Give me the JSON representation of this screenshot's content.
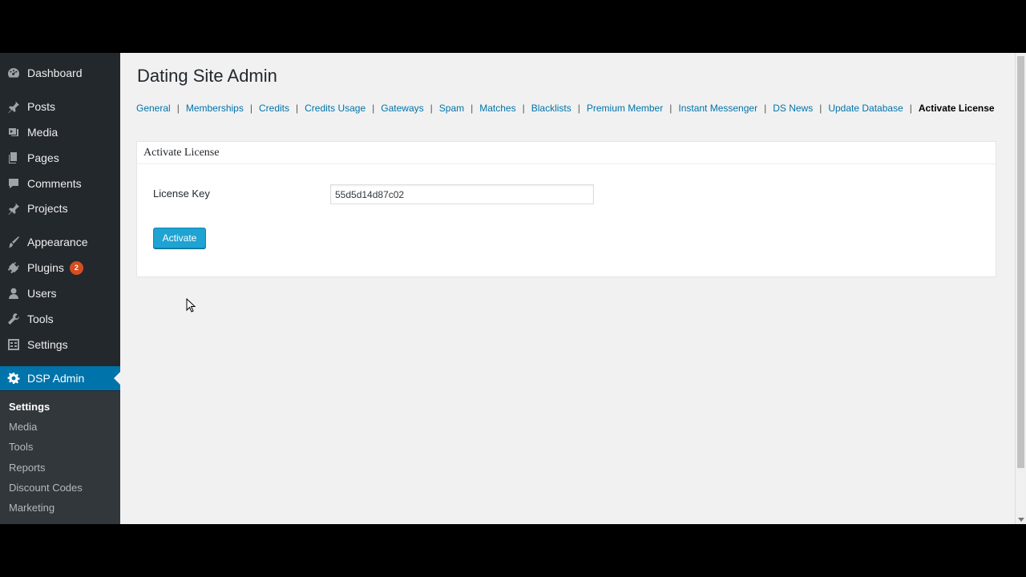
{
  "sidebar": {
    "items": [
      {
        "label": "Dashboard",
        "icon": "dashboard-icon"
      },
      {
        "label": "Posts",
        "icon": "pin-icon"
      },
      {
        "label": "Media",
        "icon": "media-icon"
      },
      {
        "label": "Pages",
        "icon": "pages-icon"
      },
      {
        "label": "Comments",
        "icon": "comment-icon"
      },
      {
        "label": "Projects",
        "icon": "pin-icon"
      },
      {
        "label": "Appearance",
        "icon": "brush-icon"
      },
      {
        "label": "Plugins",
        "icon": "plugin-icon",
        "badge": "2"
      },
      {
        "label": "Users",
        "icon": "user-icon"
      },
      {
        "label": "Tools",
        "icon": "wrench-icon"
      },
      {
        "label": "Settings",
        "icon": "settings-icon"
      },
      {
        "label": "DSP Admin",
        "icon": "gear-icon"
      }
    ],
    "submenu": [
      "Settings",
      "Media",
      "Tools",
      "Reports",
      "Discount Codes",
      "Marketing"
    ]
  },
  "page": {
    "title": "Dating Site Admin"
  },
  "tabs": [
    "General",
    "Memberships",
    "Credits",
    "Credits Usage",
    "Gateways",
    "Spam",
    "Matches",
    "Blacklists",
    "Premium Member",
    "Instant Messenger",
    "DS News",
    "Update Database",
    "Activate License"
  ],
  "panel": {
    "header": "Activate License",
    "license_label": "License Key",
    "license_value": "55d5d14d87c02",
    "button_label": "Activate"
  },
  "colors": {
    "sidebar_bg": "#23282d",
    "active_bg": "#0073aa",
    "link": "#0073aa",
    "button": "#1ea3d2",
    "badge": "#d54e21"
  }
}
